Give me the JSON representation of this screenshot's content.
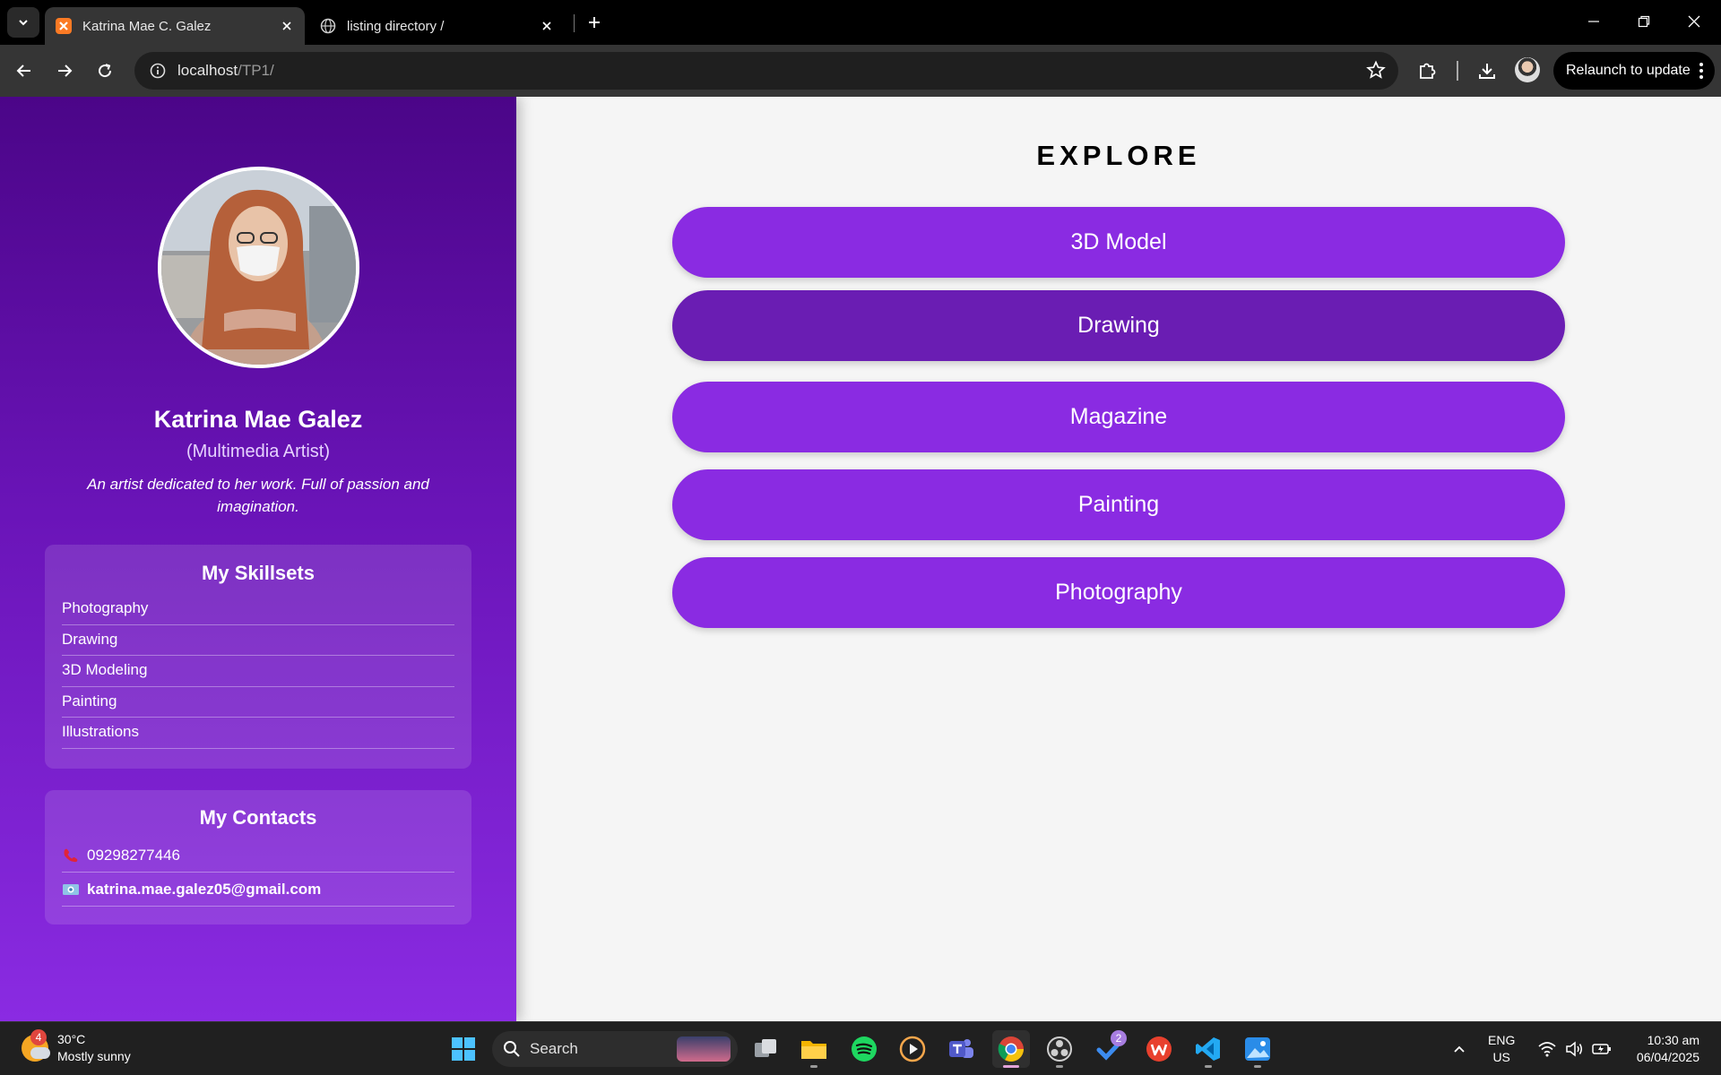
{
  "browser": {
    "tabs": [
      {
        "title": "Katrina Mae C. Galez",
        "active": true
      },
      {
        "title": "listing directory /",
        "active": false
      }
    ],
    "url_host": "localhost",
    "url_path": "/TP1/",
    "relaunch_label": "Relaunch to update"
  },
  "profile": {
    "name": "Katrina Mae Galez",
    "role": "(Multimedia Artist)",
    "bio": "An artist dedicated to her work. Full of passion and imagination."
  },
  "skills": {
    "title": "My Skillsets",
    "items": [
      "Photography",
      "Drawing",
      "3D Modeling",
      "Painting",
      "Illustrations"
    ]
  },
  "contacts": {
    "title": "My Contacts",
    "phone": "09298277446",
    "email": "katrina.mae.galez05@gmail.com"
  },
  "explore": {
    "title": "EXPLORE",
    "buttons": [
      "3D Model",
      "Drawing",
      "Magazine",
      "Painting",
      "Photography"
    ]
  },
  "taskbar": {
    "weather_temp": "30°C",
    "weather_desc": "Mostly sunny",
    "weather_badge": "4",
    "search_label": "Search",
    "todo_badge": "2",
    "lang_line1": "ENG",
    "lang_line2": "US",
    "time": "10:30 am",
    "date": "06/04/2025"
  },
  "colors": {
    "accent": "#8a2be2",
    "accent_hover": "#6a1db3",
    "sidebar_top": "#4b0588"
  }
}
